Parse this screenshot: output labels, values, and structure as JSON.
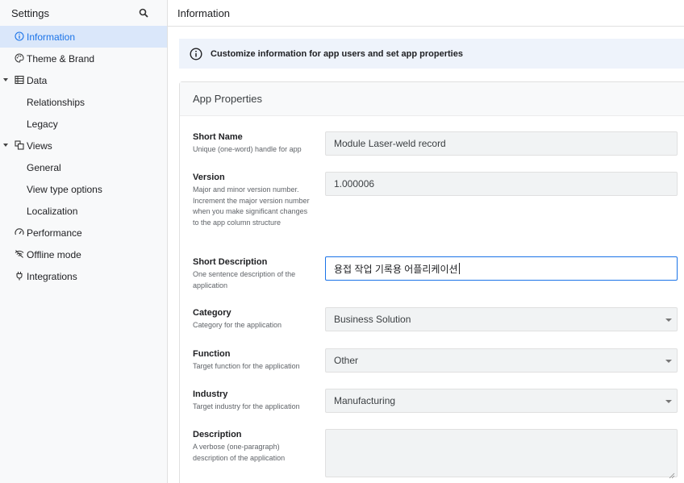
{
  "sidebar": {
    "title": "Settings",
    "search_icon": "search-icon",
    "items": [
      {
        "label": "Information",
        "icon": "info-icon",
        "active": true
      },
      {
        "label": "Theme & Brand",
        "icon": "palette-icon"
      },
      {
        "label": "Data",
        "icon": "table-icon",
        "expanded": true
      },
      {
        "label": "Relationships"
      },
      {
        "label": "Legacy"
      },
      {
        "label": "Views",
        "icon": "views-icon",
        "expanded": true
      },
      {
        "label": "General"
      },
      {
        "label": "View type options"
      },
      {
        "label": "Localization"
      },
      {
        "label": "Performance",
        "icon": "speedometer-icon"
      },
      {
        "label": "Offline mode",
        "icon": "wifi-off-icon"
      },
      {
        "label": "Integrations",
        "icon": "plug-icon"
      }
    ]
  },
  "header": {
    "title": "Information"
  },
  "banner": {
    "text": "Customize information for app users and set app properties",
    "icon": "info-icon"
  },
  "card": {
    "title": "App Properties",
    "fields": {
      "short_name": {
        "label": "Short Name",
        "desc": "Unique (one-word) handle for app",
        "value": "Module Laser-weld record"
      },
      "version": {
        "label": "Version",
        "desc": "Major and minor version number. Increment the major version number when you make significant changes to the app column structure",
        "value": "1.000006"
      },
      "short_description": {
        "label": "Short Description",
        "desc": "One sentence description of the application",
        "value": "용접 작업 기록용 어플리케이션"
      },
      "category": {
        "label": "Category",
        "desc": "Category for the application",
        "value": "Business Solution"
      },
      "function": {
        "label": "Function",
        "desc": "Target function for the application",
        "value": "Other"
      },
      "industry": {
        "label": "Industry",
        "desc": "Target industry for the application",
        "value": "Manufacturing"
      },
      "description": {
        "label": "Description",
        "desc": "A verbose (one-paragraph) description of the application",
        "value": ""
      }
    }
  },
  "colors": {
    "accent": "#1a73e8",
    "active_bg": "#dae7fa",
    "banner_bg": "#eef3fb"
  }
}
